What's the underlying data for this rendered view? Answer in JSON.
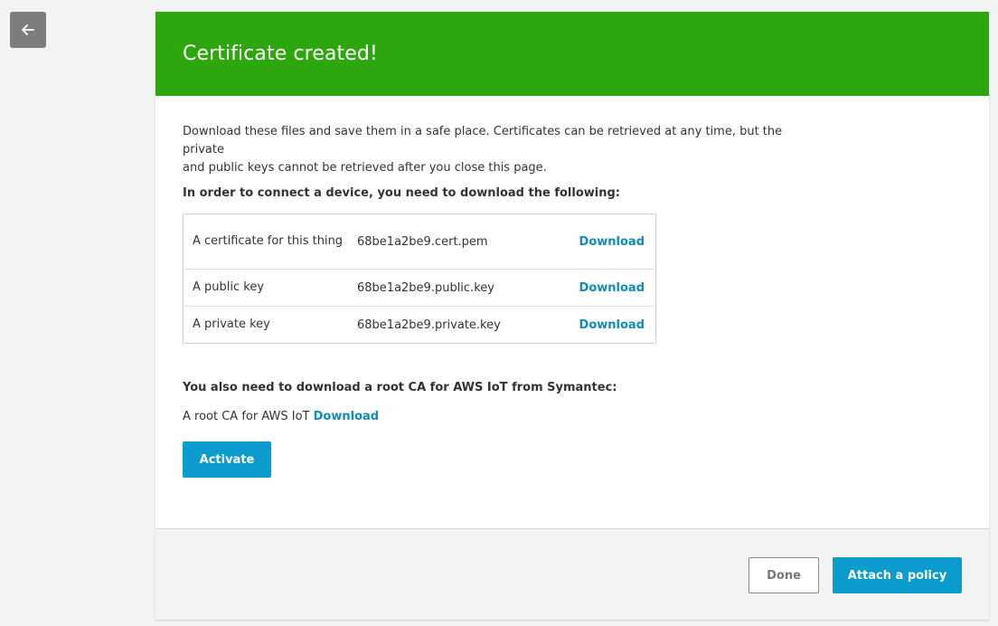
{
  "nav": {
    "back_icon": "arrow-left-icon"
  },
  "banner": {
    "title": "Certificate created!",
    "color": "#2ea60e"
  },
  "intro": {
    "line1": "Download these files and save them in a safe place. Certificates can be retrieved at any time, but the private",
    "line2": "and public keys cannot be retrieved after you close this page."
  },
  "files": {
    "heading": "In order to connect a device, you need to download the following:",
    "rows": [
      {
        "label": "A certificate for this thing",
        "file": "68be1a2be9.cert.pem",
        "action": "Download"
      },
      {
        "label": "A public key",
        "file": "68be1a2be9.public.key",
        "action": "Download"
      },
      {
        "label": "A private key",
        "file": "68be1a2be9.private.key",
        "action": "Download"
      }
    ]
  },
  "root_ca": {
    "heading": "You also need to download a root CA for AWS IoT from Symantec:",
    "label": "A root CA for AWS IoT",
    "action": "Download"
  },
  "buttons": {
    "activate": "Activate",
    "done": "Done",
    "attach_policy": "Attach a policy"
  },
  "colors": {
    "accent": "#0b9bcc",
    "link": "#0f8bbd"
  }
}
